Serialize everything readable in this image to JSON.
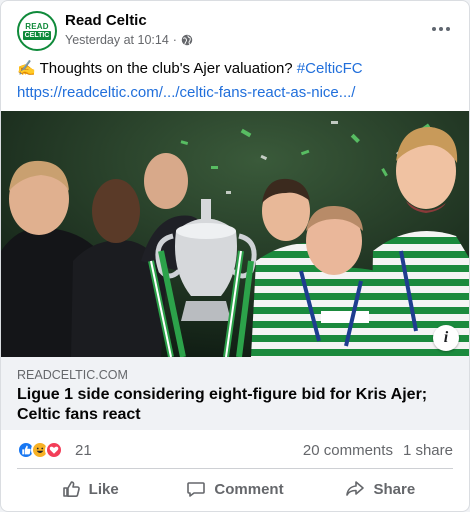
{
  "post": {
    "page_name": "Read Celtic",
    "avatar_line1": "READ",
    "avatar_line2": "CELTIC",
    "timestamp": "Yesterday at 10:14",
    "separator": "·",
    "emoji": "✍️",
    "text": "Thoughts on the club's Ajer valuation?",
    "hashtag": "#CelticFC",
    "link": "https://readceltic.com/.../celtic-fans-react-as-nice.../"
  },
  "link_preview": {
    "domain": "READCELTIC.COM",
    "headline": "Ligue 1 side considering eight-figure bid for Kris Ajer; Celtic fans react",
    "info_label": "i"
  },
  "engagement": {
    "reaction_count": "21",
    "comments": "20 comments",
    "shares": "1 share"
  },
  "actions": {
    "like": "Like",
    "comment": "Comment",
    "share": "Share"
  },
  "colors": {
    "link_blue": "#216fdb",
    "celtic_green": "#0f8a3a",
    "muted_text": "#65676b"
  }
}
